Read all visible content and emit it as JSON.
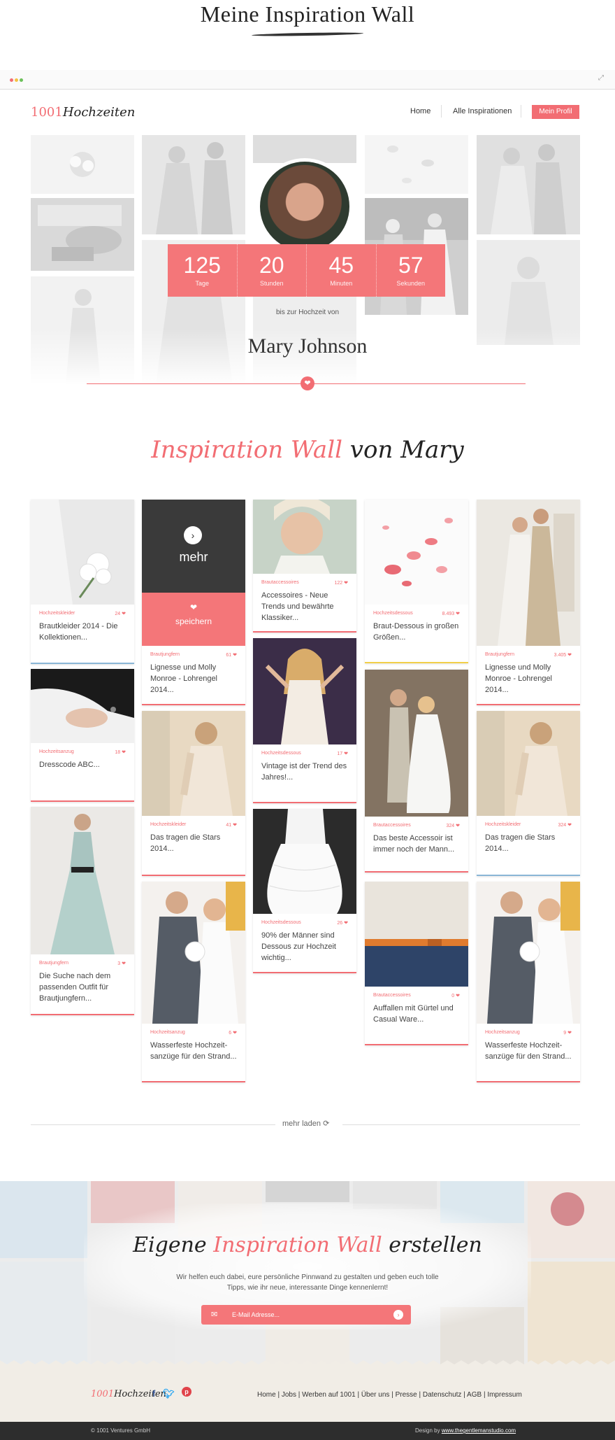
{
  "page": {
    "title": "Meine Inspiration Wall"
  },
  "header": {
    "logo_num": "1001",
    "logo_text": "Hochzeiten",
    "nav": {
      "home": "Home",
      "inspirations": "Alle Inspirationen",
      "profile": "Mein Profil"
    }
  },
  "hero": {
    "countdown": [
      {
        "value": "125",
        "unit": "Tage"
      },
      {
        "value": "20",
        "unit": "Stunden"
      },
      {
        "value": "45",
        "unit": "Minuten"
      },
      {
        "value": "57",
        "unit": "Sekunden"
      }
    ],
    "subtitle": "bis zur Hochzeit von",
    "name": "Mary Johnson"
  },
  "wall": {
    "title_pink": "Inspiration Wall",
    "title_rest": "von Mary",
    "hover": {
      "more": "mehr",
      "save": "speichern"
    },
    "cards": [
      {
        "cat": "Hochzeitskleider",
        "count": "24",
        "text": "Brautkleider 2014 - Die Kollektionen..."
      },
      {
        "cat": "Hochzeitsanzug",
        "count": "18",
        "text": "Dresscode ABC..."
      },
      {
        "cat": "Brautjungfern",
        "count": "3",
        "text": "Die Suche nach dem passenden Outfit für Brautjungfern..."
      },
      {
        "cat": "Brautjungfern",
        "count": "61",
        "text": "Lignesse und Molly Monroe - Lohrengel 2014..."
      },
      {
        "cat": "Hochzeitskleider",
        "count": "41",
        "text": "Das tragen die Stars 2014..."
      },
      {
        "cat": "Hochzeitsanzug",
        "count": "6",
        "text": "Wasserfeste Hochzeit-sanzüge für den Strand..."
      },
      {
        "cat": "Brautaccessoires",
        "count": "122",
        "text": "Accessoires - Neue Trends und bewährte Klassiker..."
      },
      {
        "cat": "Hochzeitsdessous",
        "count": "17",
        "text": "Vintage ist der Trend des Jahres!..."
      },
      {
        "cat": "Hochzeitsdessous",
        "count": "26",
        "text": "90% der Männer sind Dessous zur Hochzeit wichtig..."
      },
      {
        "cat": "Hochzeitsdessous",
        "count": "8.493",
        "text": "Braut-Dessous in großen Größen..."
      },
      {
        "cat": "Brautaccessoires",
        "count": "324",
        "text": "Das beste Accessoir ist immer noch der Mann..."
      },
      {
        "cat": "Brautaccessoires",
        "count": "0",
        "text": "Auffallen mit Gürtel und Casual Ware..."
      },
      {
        "cat": "Brautjungfern",
        "count": "3.405",
        "text": "Lignesse und Molly Monroe - Lohrengel 2014..."
      },
      {
        "cat": "Hochzeitskleider",
        "count": "324",
        "text": "Das tragen die Stars 2014..."
      },
      {
        "cat": "Hochzeitsanzug",
        "count": "9",
        "text": "Wasserfeste Hochzeit-sanzüge für den Strand..."
      }
    ],
    "more": "mehr laden"
  },
  "cta": {
    "title_pre": "Eigene",
    "title_pink": "Inspiration Wall",
    "title_post": "erstellen",
    "text": "Wir helfen euch dabei, eure persönliche Pinnwand zu gestalten und geben euch tolle Tipps, wie ihr neue, interessante Dinge kennenlernt!",
    "placeholder": "E-Mail Adresse..."
  },
  "footer": {
    "links": [
      "Home",
      "Jobs",
      "Werben auf 1001",
      "Über uns",
      "Presse",
      "Datenschutz",
      "AGB",
      "Impressum"
    ],
    "copyright": "© 1001 Ventures GmbH",
    "design_pre": "Design by",
    "design_link": "www.thegentlemanstudio.com"
  },
  "icons": [
    "facebook-icon",
    "twitter-icon",
    "pinterest-icon",
    "heart-icon",
    "arrow-right-icon",
    "mail-icon",
    "expand-icon"
  ],
  "colors": {
    "accent": "#f26d73",
    "dark": "#2d2d2d",
    "footer_bg": "#f1ede6"
  }
}
